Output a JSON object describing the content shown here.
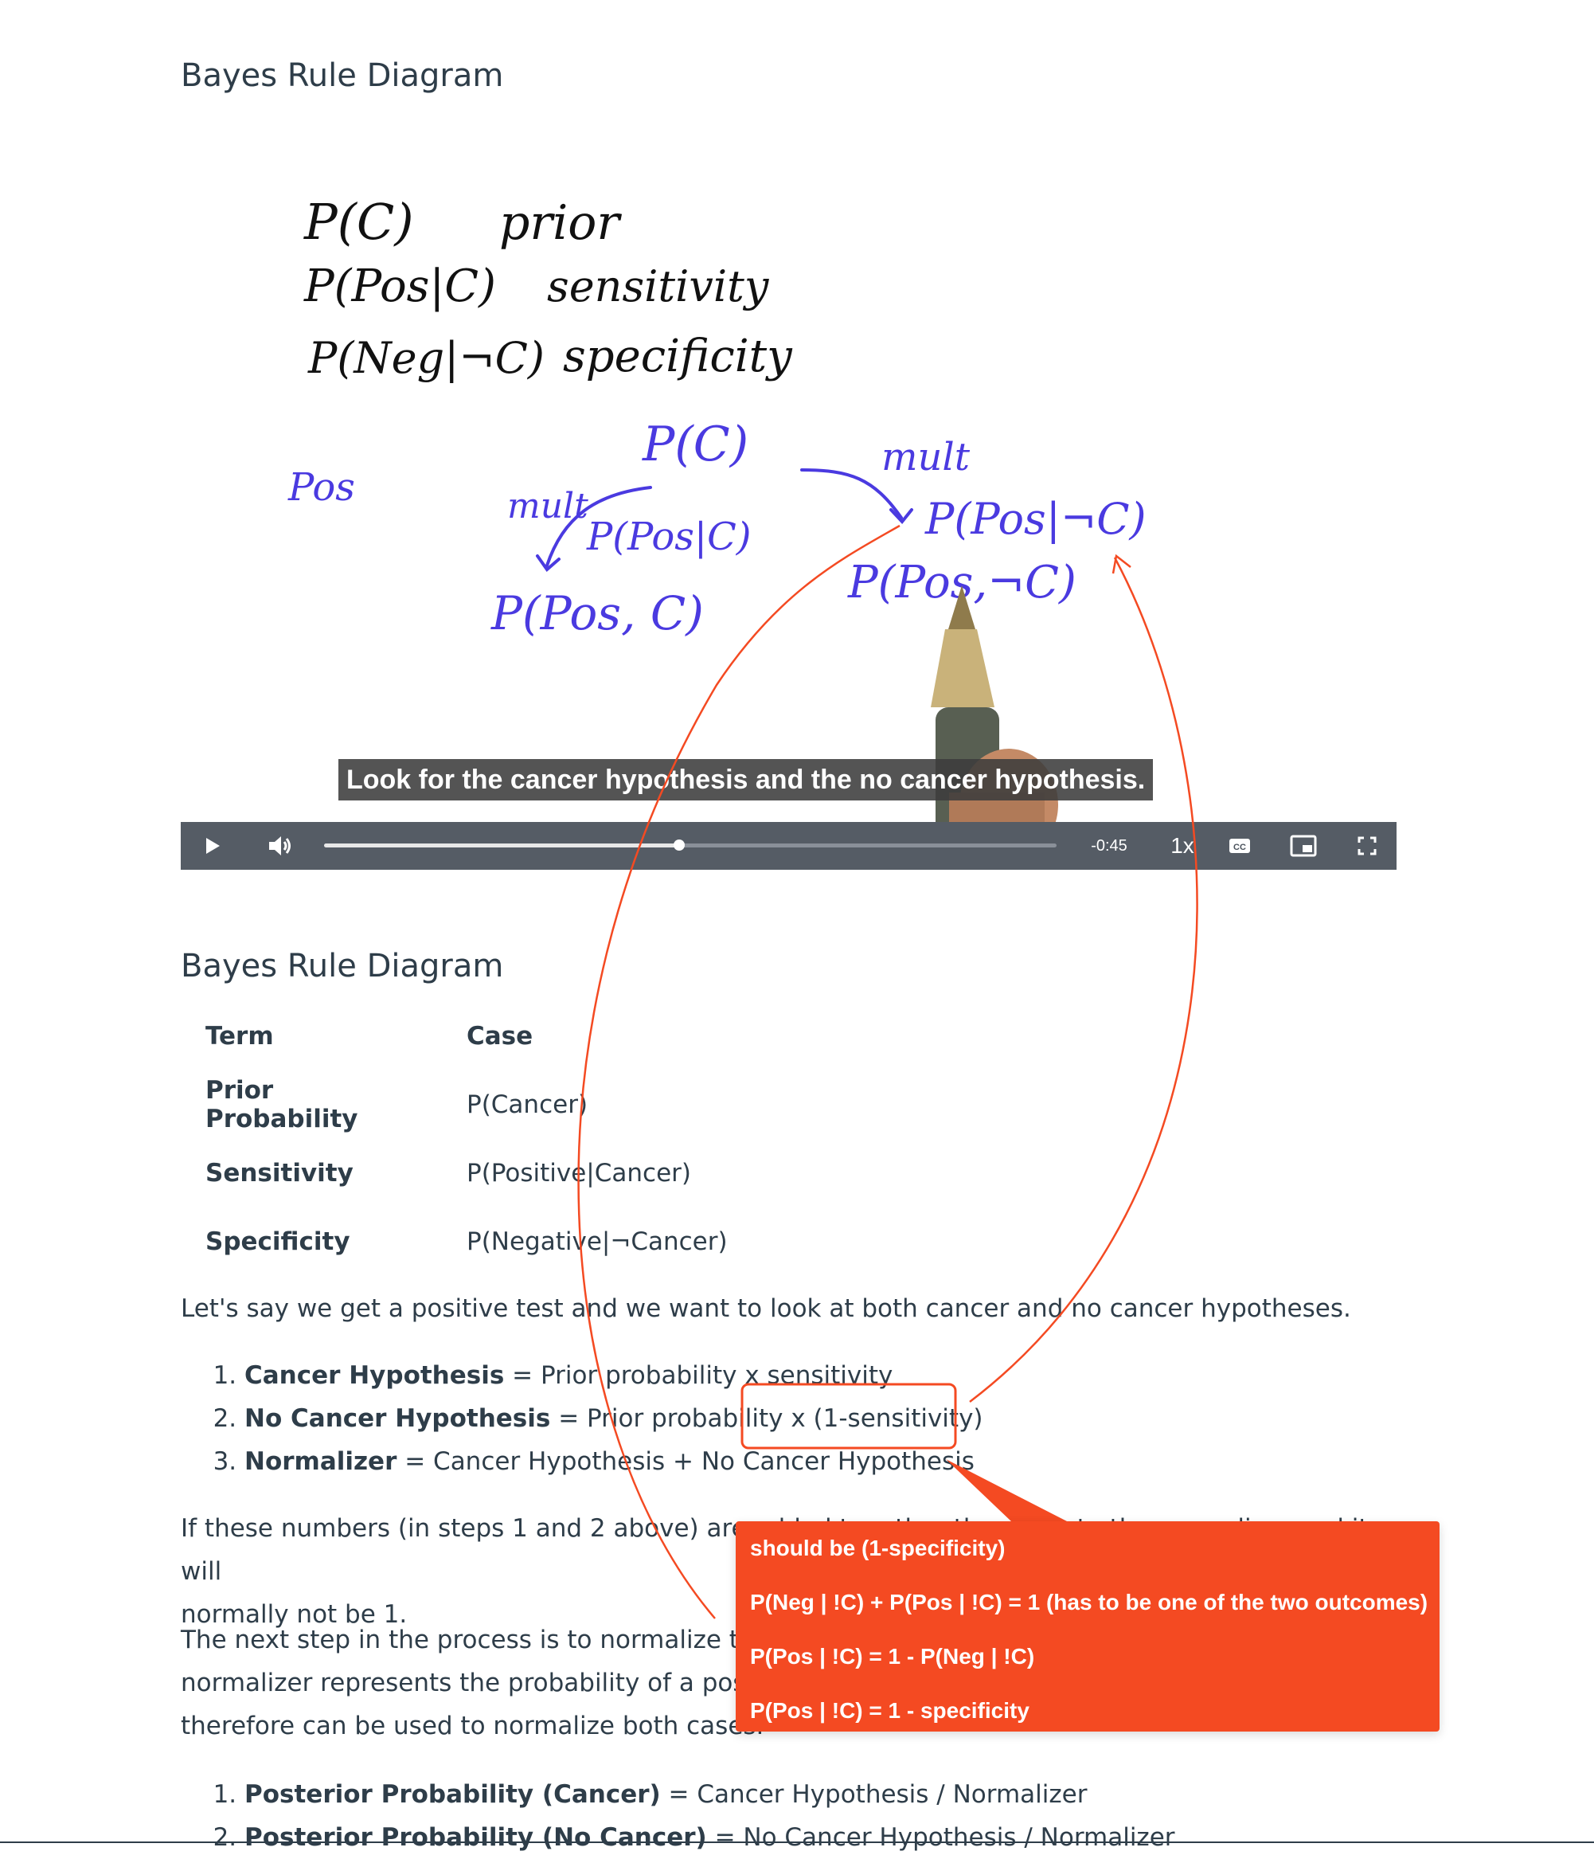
{
  "page": {
    "title": "Bayes Rule Diagram",
    "section_title": "Bayes Rule Diagram"
  },
  "video": {
    "board": {
      "line1_a": "P(C)",
      "line1_b": "prior",
      "line2_a": "P(Pos|C)",
      "line2_b": "sensitivity",
      "line3_a": "P(Neg|¬C)",
      "line3_b": "specificity",
      "pos": "Pos",
      "pc": "P(C)",
      "mult_left": "mult",
      "mult_right": "mult",
      "pposc": "P(Pos|C)",
      "pposnotc": "P(Pos|¬C)",
      "joint_c": "P(Pos, C)",
      "joint_notc": "P(Pos,¬C)"
    },
    "caption": "Look for the cancer hypothesis and the no cancer hypothesis.",
    "controls": {
      "play_icon": "play-icon",
      "volume_icon": "volume-icon",
      "progress": 0.485,
      "time_remaining": "-0:45",
      "speed": "1x",
      "cc_label": "CC",
      "pip_icon": "picture-in-picture-icon",
      "fullscreen_icon": "fullscreen-icon"
    }
  },
  "table": {
    "headers": [
      "Term",
      "Case"
    ],
    "rows": [
      {
        "term": "Prior Probability",
        "case": "P(Cancer)"
      },
      {
        "term": "Sensitivity",
        "case": "P(Positive|Cancer)"
      },
      {
        "term": "Specificity",
        "case": "P(Negative|¬Cancer)"
      }
    ]
  },
  "intro": "Let's say we get a positive test and we want to look at both cancer and no cancer hypotheses.",
  "steps": [
    {
      "bold": "Cancer Hypothesis",
      "rest": " = Prior probability x sensitivity"
    },
    {
      "bold": "No Cancer Hypothesis",
      "rest": " = Prior probability x (1-sensitivity)"
    },
    {
      "bold": "Normalizer",
      "rest": " = Cancer Hypothesis + No Cancer Hypothesis"
    }
  ],
  "para2_line1": "If these numbers (in steps 1 and 2 above) are a",
  "para2_line1_tail": "dded together they sum to the normalizer and it will",
  "para2_line2": "normally not be 1.",
  "para3_line1": "The next step in the process is to normalize the",
  "para3_line2": "normalizer represents the probability of a posi",
  "para3_line3": "therefore can be used to normalize both cases.",
  "posteriors": [
    {
      "bold": "Posterior Probability (Cancer)",
      "rest": " = Cancer Hypothesis / Normalizer"
    },
    {
      "bold": "Posterior Probability (No Cancer)",
      "rest": " = No Cancer Hypothesis / Normalizer"
    }
  ],
  "annotation": {
    "color": "#f44a22",
    "lines": [
      "should be (1-specificity)",
      "P(Neg | !C) + P(Pos | !C) = 1 (has to be one of the two outcomes)",
      " P(Pos | !C) = 1 - P(Neg | !C)",
      " P(Pos | !C) = 1 - specificity"
    ]
  }
}
